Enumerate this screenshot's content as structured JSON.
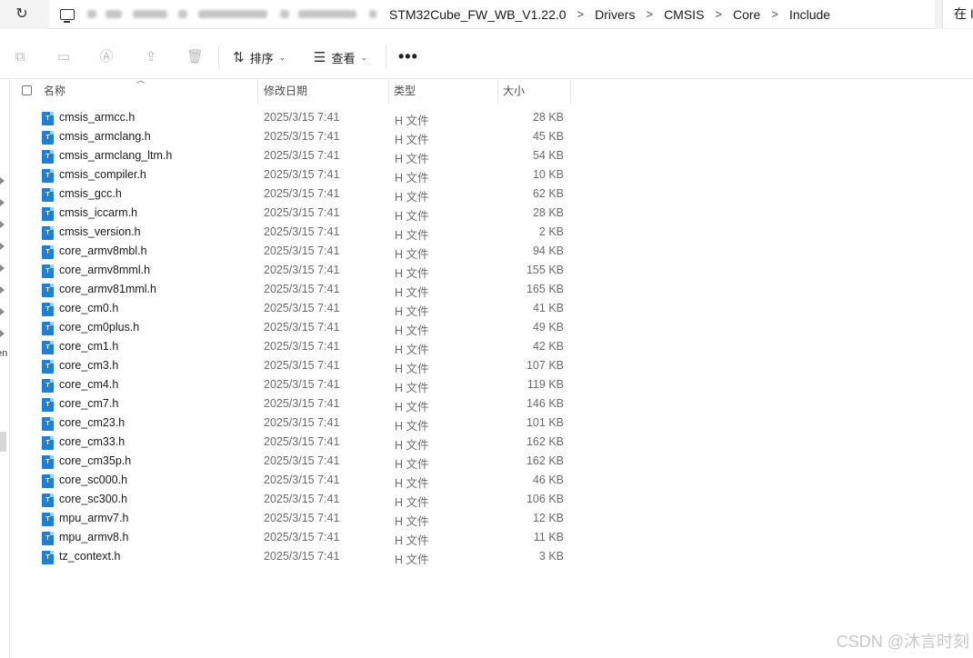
{
  "address_bar": {
    "refresh_glyph": "↻",
    "crumbs": [
      "STM32Cube_FW_WB_V1.22.0",
      "Drivers",
      "CMSIS",
      "Core",
      "Include"
    ],
    "separator": ">",
    "search_text": "在 I"
  },
  "toolbar": {
    "sort_label": "排序",
    "view_label": "查看",
    "more_label": "•••"
  },
  "nav": {
    "partial_text": "en"
  },
  "columns": {
    "name": "名称",
    "date": "修改日期",
    "type": "类型",
    "size": "大小"
  },
  "files": [
    {
      "name": "cmsis_armcc.h",
      "date": "2025/3/15 7:41",
      "type": "H 文件",
      "size": "28 KB"
    },
    {
      "name": "cmsis_armclang.h",
      "date": "2025/3/15 7:41",
      "type": "H 文件",
      "size": "45 KB"
    },
    {
      "name": "cmsis_armclang_ltm.h",
      "date": "2025/3/15 7:41",
      "type": "H 文件",
      "size": "54 KB"
    },
    {
      "name": "cmsis_compiler.h",
      "date": "2025/3/15 7:41",
      "type": "H 文件",
      "size": "10 KB"
    },
    {
      "name": "cmsis_gcc.h",
      "date": "2025/3/15 7:41",
      "type": "H 文件",
      "size": "62 KB"
    },
    {
      "name": "cmsis_iccarm.h",
      "date": "2025/3/15 7:41",
      "type": "H 文件",
      "size": "28 KB"
    },
    {
      "name": "cmsis_version.h",
      "date": "2025/3/15 7:41",
      "type": "H 文件",
      "size": "2 KB"
    },
    {
      "name": "core_armv8mbl.h",
      "date": "2025/3/15 7:41",
      "type": "H 文件",
      "size": "94 KB"
    },
    {
      "name": "core_armv8mml.h",
      "date": "2025/3/15 7:41",
      "type": "H 文件",
      "size": "155 KB"
    },
    {
      "name": "core_armv81mml.h",
      "date": "2025/3/15 7:41",
      "type": "H 文件",
      "size": "165 KB"
    },
    {
      "name": "core_cm0.h",
      "date": "2025/3/15 7:41",
      "type": "H 文件",
      "size": "41 KB"
    },
    {
      "name": "core_cm0plus.h",
      "date": "2025/3/15 7:41",
      "type": "H 文件",
      "size": "49 KB"
    },
    {
      "name": "core_cm1.h",
      "date": "2025/3/15 7:41",
      "type": "H 文件",
      "size": "42 KB"
    },
    {
      "name": "core_cm3.h",
      "date": "2025/3/15 7:41",
      "type": "H 文件",
      "size": "107 KB"
    },
    {
      "name": "core_cm4.h",
      "date": "2025/3/15 7:41",
      "type": "H 文件",
      "size": "119 KB"
    },
    {
      "name": "core_cm7.h",
      "date": "2025/3/15 7:41",
      "type": "H 文件",
      "size": "146 KB"
    },
    {
      "name": "core_cm23.h",
      "date": "2025/3/15 7:41",
      "type": "H 文件",
      "size": "101 KB"
    },
    {
      "name": "core_cm33.h",
      "date": "2025/3/15 7:41",
      "type": "H 文件",
      "size": "162 KB"
    },
    {
      "name": "core_cm35p.h",
      "date": "2025/3/15 7:41",
      "type": "H 文件",
      "size": "162 KB"
    },
    {
      "name": "core_sc000.h",
      "date": "2025/3/15 7:41",
      "type": "H 文件",
      "size": "46 KB"
    },
    {
      "name": "core_sc300.h",
      "date": "2025/3/15 7:41",
      "type": "H 文件",
      "size": "106 KB"
    },
    {
      "name": "mpu_armv7.h",
      "date": "2025/3/15 7:41",
      "type": "H 文件",
      "size": "12 KB"
    },
    {
      "name": "mpu_armv8.h",
      "date": "2025/3/15 7:41",
      "type": "H 文件",
      "size": "11 KB"
    },
    {
      "name": "tz_context.h",
      "date": "2025/3/15 7:41",
      "type": "H 文件",
      "size": "3 KB"
    }
  ],
  "watermark": "CSDN @沐言时刻",
  "colors": {
    "file_icon": "#1e7fd6",
    "text_secondary": "#6b6b6b",
    "toolbar_disabled": "#b9b9b9"
  }
}
